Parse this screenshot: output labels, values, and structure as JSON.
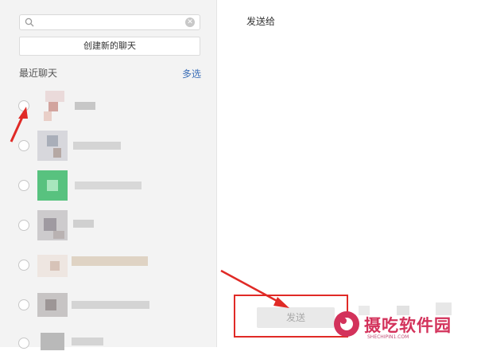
{
  "search": {
    "placeholder": ""
  },
  "create_chat_label": "创建新的聊天",
  "recent_title": "最近聊天",
  "multi_select_label": "多选",
  "send_to_title": "发送给",
  "send_button_label": "发送",
  "watermark": {
    "text": "摄吃软件园",
    "sub": "SHECHIPIN1.COM"
  },
  "colors": {
    "accent_link": "#3b6eb7",
    "annotation_red": "#e02a26",
    "watermark": "#d3325b"
  }
}
